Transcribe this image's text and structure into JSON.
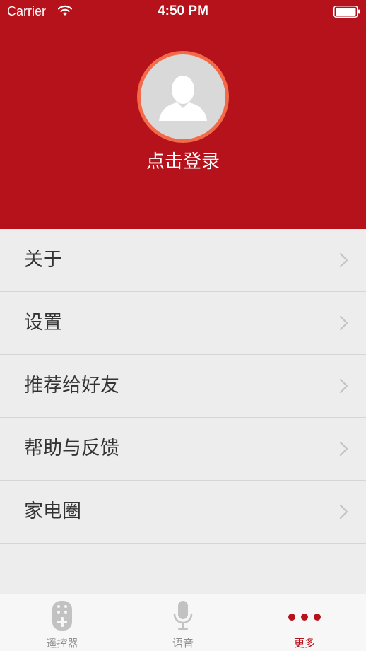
{
  "status_bar": {
    "carrier": "Carrier",
    "time": "4:50 PM"
  },
  "header": {
    "background_color": "#b5121b",
    "avatar_ring_color": "#f26a47",
    "login_label": "点击登录"
  },
  "menu": {
    "items": [
      {
        "label": "关于"
      },
      {
        "label": "设置"
      },
      {
        "label": "推荐给好友"
      },
      {
        "label": "帮助与反馈"
      },
      {
        "label": "家电圈"
      }
    ]
  },
  "tab_bar": {
    "active_color": "#b5121b",
    "inactive_color": "#8e8e8e",
    "tabs": [
      {
        "label": "遥控器",
        "icon": "remote-control-icon",
        "active": false
      },
      {
        "label": "语音",
        "icon": "microphone-icon",
        "active": false
      },
      {
        "label": "更多",
        "icon": "more-dots-icon",
        "active": true
      }
    ]
  }
}
